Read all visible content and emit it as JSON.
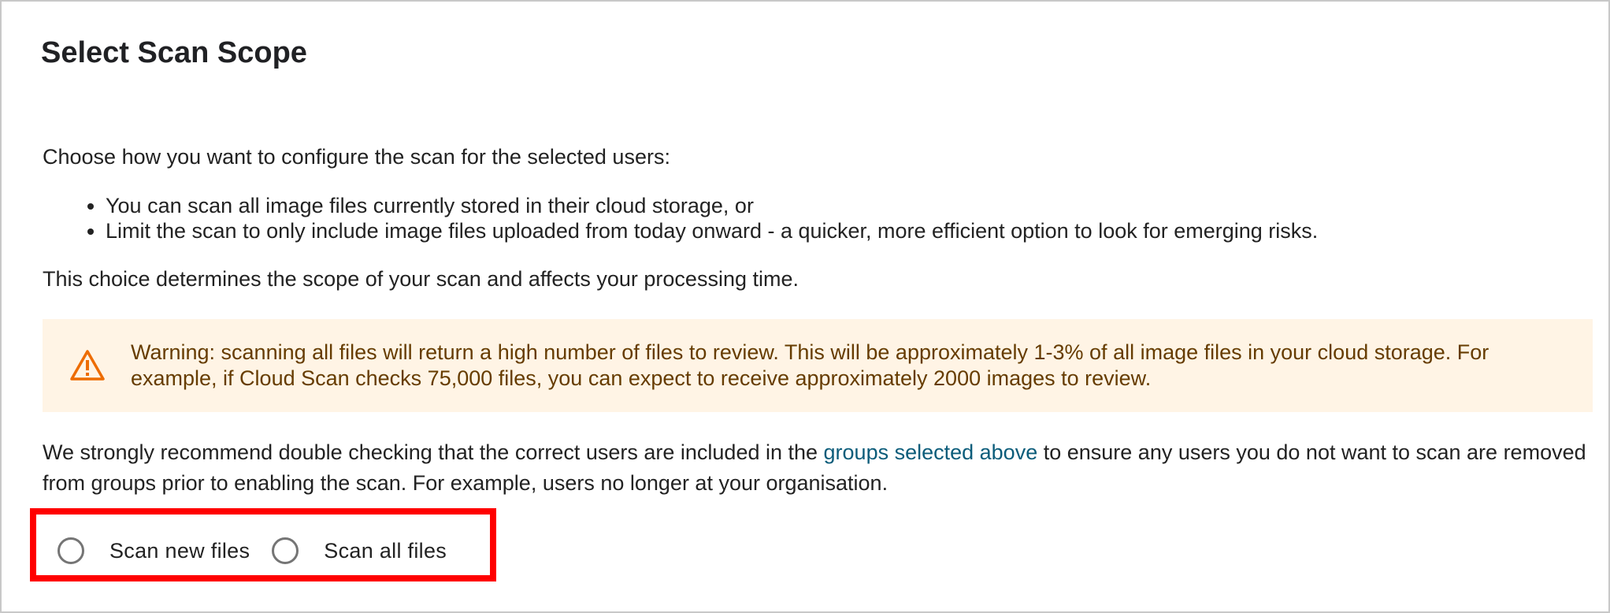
{
  "title": "Select Scan Scope",
  "intro": "Choose how you want to configure the scan for the selected users:",
  "bullets": [
    "You can scan all image files currently stored in their cloud storage, or",
    "Limit the scan to only include image files uploaded from today onward - a quicker, more efficient option to look for emerging risks."
  ],
  "determines": "This choice determines the scope of your scan and affects your processing time.",
  "warning": {
    "icon": "warning-triangle-icon",
    "text": "Warning: scanning all files will return a high number of files to review. This will be approximately 1-3% of all image files in your cloud storage. For example, if Cloud Scan checks 75,000 files, you can expect to receive approximately 2000 images to review.",
    "background_color": "#fff4e5",
    "text_color": "#663c00",
    "icon_color": "#ed6c02"
  },
  "recommend": {
    "before": "We strongly recommend double checking that the correct users are included in the ",
    "link": "groups selected above",
    "after": " to ensure any users you do not want to scan are removed from groups prior to enabling the scan. For example, users no longer at your organisation.",
    "link_color": "#0b5c7a"
  },
  "scan_options": [
    {
      "label": "Scan new files",
      "selected": false
    },
    {
      "label": "Scan all files",
      "selected": false
    }
  ],
  "highlight_color": "#ff0000"
}
